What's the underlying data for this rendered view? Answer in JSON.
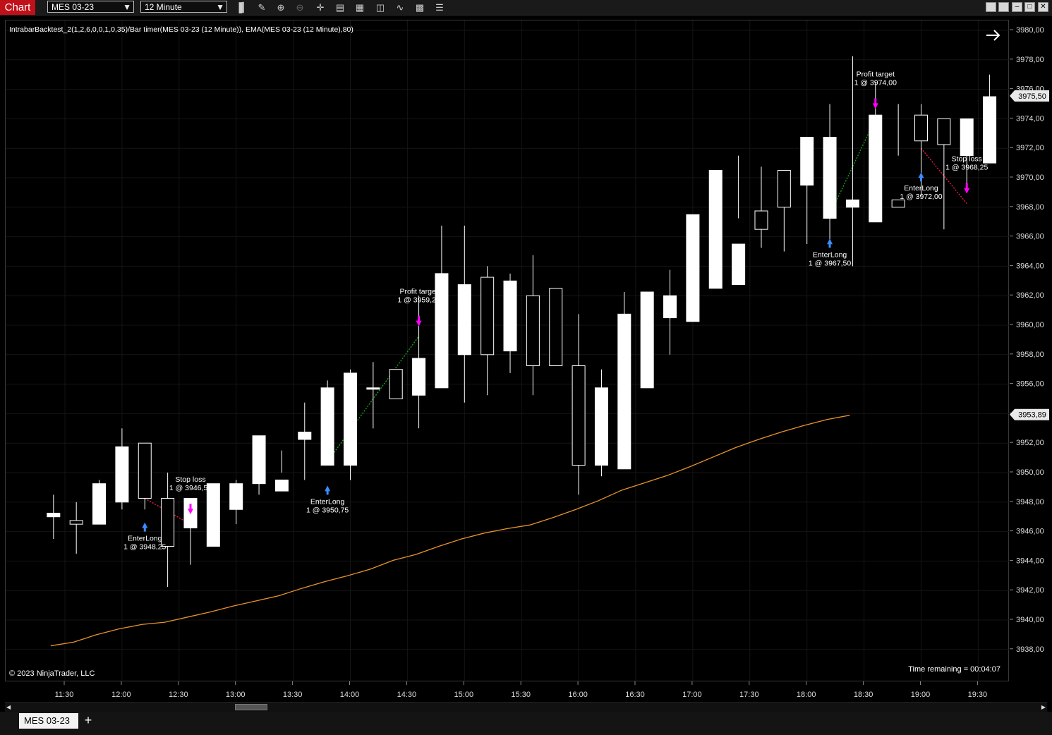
{
  "toolbar": {
    "chart_tab": "Chart",
    "instrument": "MES 03-23",
    "interval": "12 Minute"
  },
  "chart": {
    "indicator_label": "IntrabarBacktest_2(1,2,6,0,0,1,0,35)/Bar timer(MES 03-23 (12 Minute)), EMA(MES 03-23 (12 Minute),80)",
    "copyright": "© 2023 NinjaTrader, LLC",
    "time_remaining": "Time remaining = 00:04:07",
    "price_axis": [
      "3980,00",
      "3978,00",
      "3976,00",
      "3974,00",
      "3972,00",
      "3970,00",
      "3968,00",
      "3966,00",
      "3964,00",
      "3962,00",
      "3960,00",
      "3958,00",
      "3956,00",
      "3954,00",
      "3952,00",
      "3950,00",
      "3948,00",
      "3946,00",
      "3944,00",
      "3942,00",
      "3940,00",
      "3938,00"
    ],
    "time_axis": [
      "11:30",
      "12:00",
      "12:30",
      "13:00",
      "13:30",
      "14:00",
      "14:30",
      "15:00",
      "15:30",
      "16:00",
      "16:30",
      "17:00",
      "17:30",
      "18:00",
      "18:30",
      "19:00",
      "19:30"
    ],
    "last_price_tag": "3975,50",
    "ema_tag": "3953,89",
    "colors": {
      "candle": "#ffffff",
      "ema": "#e8922a",
      "buy_arrow": "#1c8a1c",
      "exit_marker": "#ff00ff",
      "entry_marker": "#3a8cff",
      "level": "#8a8a1a",
      "win_line": "#19a019",
      "loss_line": "#e02040"
    }
  },
  "chart_data": {
    "type": "candlestick",
    "x": [
      "11:24",
      "11:36",
      "11:48",
      "12:00",
      "12:12",
      "12:24",
      "12:36",
      "12:48",
      "13:00",
      "13:12",
      "13:24",
      "13:36",
      "13:48",
      "14:00",
      "14:12",
      "14:24",
      "14:36",
      "14:48",
      "15:00",
      "15:12",
      "15:24",
      "15:36",
      "15:48",
      "16:00",
      "16:12",
      "16:24",
      "16:36",
      "16:48",
      "17:00",
      "17:12",
      "17:24",
      "17:36",
      "17:48",
      "18:00",
      "18:12",
      "18:24",
      "18:36",
      "18:48",
      "19:00",
      "19:12",
      "19:24",
      "19:36"
    ],
    "open": [
      3947.0,
      3946.75,
      3946.5,
      3948.0,
      3952.0,
      3948.25,
      3946.25,
      3945.0,
      3947.5,
      3949.25,
      3948.75,
      3952.25,
      3950.5,
      3950.5,
      3955.75,
      3957.0,
      3955.25,
      3955.75,
      3958.0,
      3963.25,
      3958.25,
      3962.0,
      3962.5,
      3957.25,
      3950.5,
      3950.25,
      3955.75,
      3960.5,
      3960.25,
      3962.5,
      3962.75,
      3967.75,
      3970.5,
      3969.5,
      3967.25,
      3968.0,
      3967.0,
      3968.5,
      3974.25,
      3974.0,
      3971.5,
      3971.0,
      3973.75
    ],
    "high": [
      3948.5,
      3948.0,
      3949.5,
      3953.0,
      3952.0,
      3950.0,
      3946.75,
      3948.0,
      3949.5,
      3951.0,
      3951.5,
      3954.75,
      3956.25,
      3957.0,
      3957.5,
      3956.5,
      3962.0,
      3966.75,
      3966.75,
      3964.0,
      3963.5,
      3964.75,
      3959.75,
      3960.75,
      3957.0,
      3962.25,
      3960.75,
      3963.75,
      3964.5,
      3968.75,
      3971.5,
      3970.75,
      3968.0,
      3970.5,
      3975.0,
      3978.25,
      3976.5,
      3975.0,
      3975.0,
      3973.0,
      3974.0,
      3977.0,
      3977.0
    ],
    "low": [
      3945.5,
      3944.5,
      3946.5,
      3947.5,
      3947.5,
      3942.25,
      3943.75,
      3946.0,
      3946.5,
      3948.5,
      3950.0,
      3949.5,
      3953.0,
      3949.5,
      3953.0,
      3956.75,
      3953.0,
      3958.0,
      3954.75,
      3955.25,
      3956.75,
      3955.25,
      3957.25,
      3948.5,
      3949.75,
      3955.25,
      3959.25,
      3958.0,
      3961.5,
      3962.75,
      3967.25,
      3965.25,
      3965.0,
      3965.5,
      3965.5,
      3964.0,
      3968.5,
      3971.5,
      3968.75,
      3966.5,
      3969.0,
      3972.0,
      3972.5
    ],
    "close": [
      3947.25,
      3946.5,
      3949.25,
      3951.75,
      3948.25,
      3945.0,
      3948.25,
      3949.25,
      3949.25,
      3952.5,
      3949.5,
      3952.75,
      3955.75,
      3956.75,
      3955.75,
      3955.0,
      3957.75,
      3963.5,
      3962.75,
      3958.0,
      3963.0,
      3957.25,
      3957.25,
      3950.5,
      3955.75,
      3960.75,
      3962.25,
      3962.0,
      3967.5,
      3970.5,
      3965.5,
      3966.5,
      3968.0,
      3972.75,
      3972.75,
      3968.5,
      3974.25,
      3968.0,
      3972.5,
      3972.25,
      3974.0,
      3975.5
    ],
    "ema": [
      3938.25,
      3938.5,
      3939.0,
      3939.4,
      3939.7,
      3939.85,
      3940.2,
      3940.55,
      3940.95,
      3941.3,
      3941.65,
      3942.15,
      3942.6,
      3943.0,
      3943.45,
      3944.05,
      3944.45,
      3945.0,
      3945.5,
      3945.9,
      3946.2,
      3946.45,
      3946.95,
      3947.5,
      3948.1,
      3948.8,
      3949.3,
      3949.8,
      3950.4,
      3951.05,
      3951.7,
      3952.25,
      3952.75,
      3953.2,
      3953.6,
      3953.89
    ]
  },
  "trades": [
    {
      "type": "entry",
      "label": "EnterLong",
      "detail": "1 @ 3948,25"
    },
    {
      "type": "exit",
      "label": "Stop loss",
      "detail": "1 @ 3946,50"
    },
    {
      "type": "entry",
      "label": "EnterLong",
      "detail": "1 @ 3950,75"
    },
    {
      "type": "exit",
      "label": "Profit target",
      "detail": "1 @ 3959,25"
    },
    {
      "type": "entry",
      "label": "EnterLong",
      "detail": "1 @ 3967,50"
    },
    {
      "type": "exit",
      "label": "Profit target",
      "detail": "1 @ 3974,00"
    },
    {
      "type": "entry",
      "label": "EnterLong",
      "detail": "1 @ 3972,00"
    },
    {
      "type": "exit",
      "label": "Stop loss",
      "detail": "1 @ 3968,25"
    }
  ],
  "bottom": {
    "tab": "MES 03-23",
    "add": "+"
  }
}
